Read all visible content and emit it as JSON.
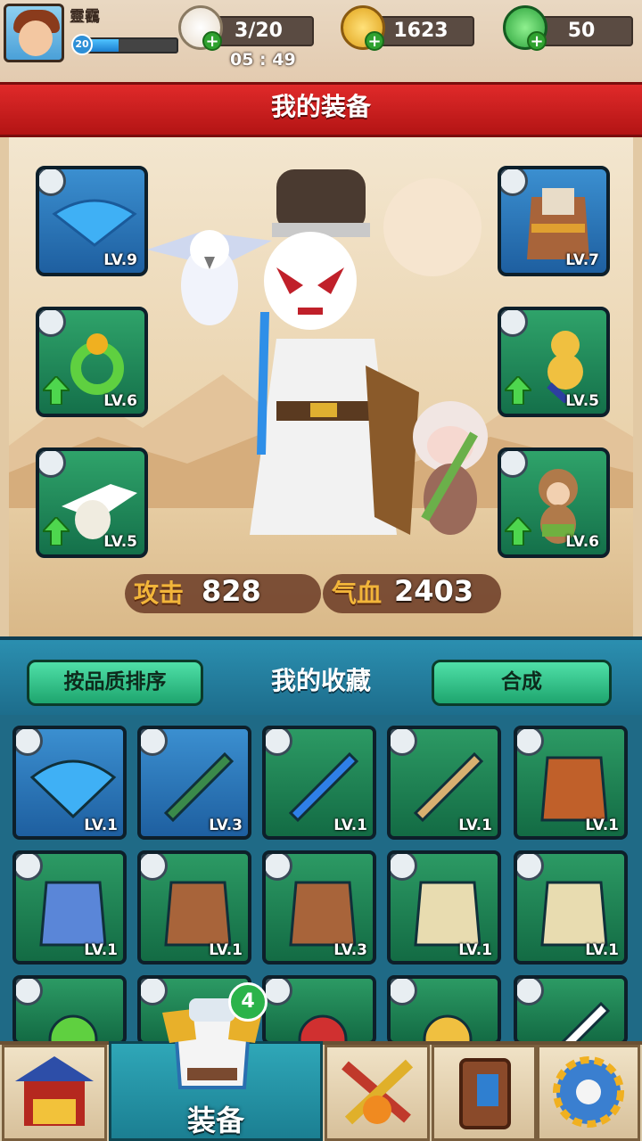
{
  "player": {
    "name": "靈靏",
    "level": "20",
    "xp_fraction": 0.35
  },
  "resources": [
    {
      "id": "stamina",
      "icon": "bun-icon",
      "value": "3/20"
    },
    {
      "id": "gold",
      "icon": "gold-leaf-icon",
      "value": "1623"
    },
    {
      "id": "jade",
      "icon": "jade-leaf-icon",
      "value": "50"
    }
  ],
  "timer": "05 : 49",
  "equipment_panel": {
    "title": "我的装备",
    "slots_left": [
      {
        "item": "fan-weapon",
        "level": "LV.9",
        "slot_type": "sword-icon"
      },
      {
        "item": "jade-ring-accessory",
        "level": "LV.6",
        "slot_type": "ring-icon",
        "upgradeable": true
      },
      {
        "item": "owl-pet",
        "level": "LV.5",
        "slot_type": "paw-icon",
        "upgradeable": true
      }
    ],
    "slots_right": [
      {
        "item": "armor-robe",
        "level": "LV.7",
        "slot_type": "armor-icon"
      },
      {
        "item": "gourd-charm-accessory",
        "level": "LV.5",
        "slot_type": "ring-icon",
        "upgradeable": true
      },
      {
        "item": "monkey-pet",
        "level": "LV.6",
        "slot_type": "paw-icon",
        "upgradeable": true
      }
    ],
    "stats": {
      "attack_label": "攻击",
      "attack_value": "828",
      "hp_label": "气血",
      "hp_value": "2403"
    }
  },
  "collection": {
    "sort_button": "按品质排序",
    "title": "我的收藏",
    "merge_button": "合成",
    "rows": [
      [
        {
          "item": "fan-weapon",
          "level": "LV.1",
          "slot_type": "sword-icon",
          "rarity": "blue"
        },
        {
          "item": "crossbow-weapon",
          "level": "LV.3",
          "slot_type": "sword-icon",
          "rarity": "blue"
        },
        {
          "item": "blue-sword-weapon",
          "level": "LV.1",
          "slot_type": "sword-icon",
          "rarity": "green"
        },
        {
          "item": "horn-weapon",
          "level": "LV.1",
          "slot_type": "sword-icon",
          "rarity": "green"
        },
        {
          "item": "orange-cloak-armor",
          "level": "LV.1",
          "slot_type": "armor-icon",
          "rarity": "green"
        }
      ],
      [
        {
          "item": "blue-fur-robe-armor",
          "level": "LV.1",
          "slot_type": "armor-icon",
          "rarity": "green"
        },
        {
          "item": "brown-robe-armor",
          "level": "LV.1",
          "slot_type": "armor-icon",
          "rarity": "green"
        },
        {
          "item": "brown-robe-armor",
          "level": "LV.3",
          "slot_type": "armor-icon",
          "rarity": "green"
        },
        {
          "item": "cream-robe-armor",
          "level": "LV.1",
          "slot_type": "armor-icon",
          "rarity": "green"
        },
        {
          "item": "cream-robe-armor",
          "level": "LV.1",
          "slot_type": "armor-icon",
          "rarity": "green"
        }
      ],
      [
        {
          "item": "jade-ring-accessory",
          "level": "",
          "slot_type": "ring-icon",
          "rarity": "green"
        },
        {
          "item": "charm-accessory",
          "level": "",
          "slot_type": "ring-icon",
          "rarity": "green"
        },
        {
          "item": "phoenix-charm-accessory",
          "level": "",
          "slot_type": "ring-icon",
          "rarity": "green"
        },
        {
          "item": "gourd-charm-accessory",
          "level": "",
          "slot_type": "ring-icon",
          "rarity": "green"
        },
        {
          "item": "owl-pet",
          "level": "",
          "slot_type": "paw-icon",
          "rarity": "green"
        }
      ]
    ]
  },
  "bottom_nav": {
    "items": [
      {
        "id": "shop",
        "icon": "treasure-house-icon"
      },
      {
        "id": "equipment",
        "icon": "armor-icon",
        "label": "装备",
        "badge": "4",
        "active": true
      },
      {
        "id": "battle",
        "icon": "crossed-weapons-icon"
      },
      {
        "id": "book",
        "icon": "book-icon"
      },
      {
        "id": "settings",
        "icon": "gear-icon"
      }
    ]
  },
  "colors": {
    "banner": "#c81e1e",
    "panel_bg": "#f0e0c4",
    "collection_bg": "#1f6a86",
    "button_green": "#2fc78a",
    "attack_label": "#f2b53a"
  }
}
